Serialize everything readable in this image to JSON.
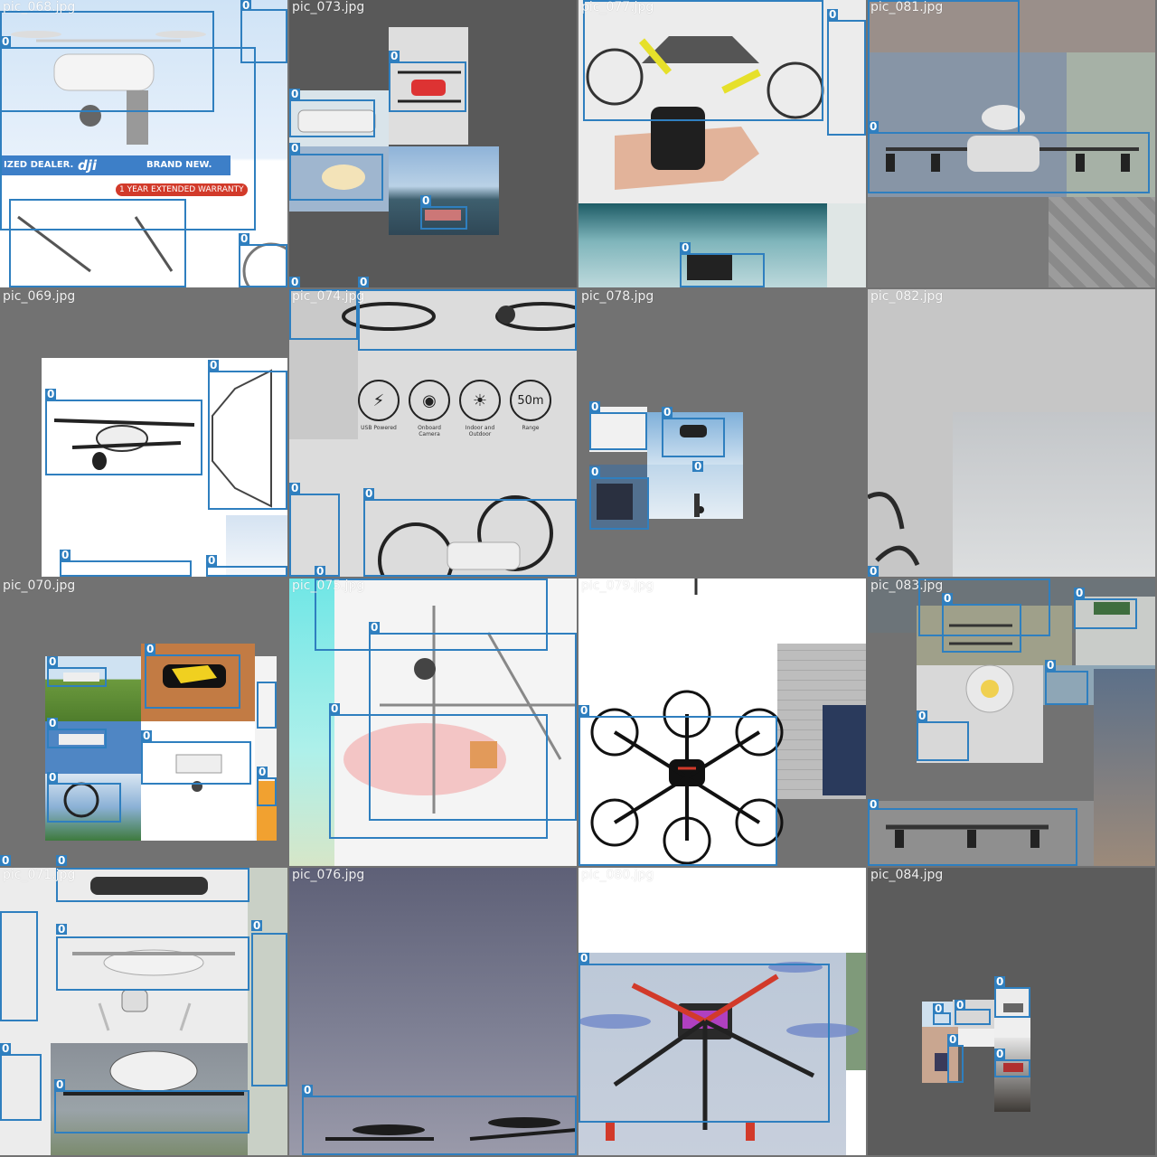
{
  "mosaic": {
    "class_label": "0",
    "box_color": "#2f7fbf",
    "tiles": [
      {
        "name": "pic_068.jpg",
        "label": "pic_068.jpg"
      },
      {
        "name": "pic_073.jpg",
        "label": "pic_073.jpg"
      },
      {
        "name": "pic_077.jpg",
        "label": "pic_077.jpg"
      },
      {
        "name": "pic_081.jpg",
        "label": "pic_081.jpg"
      },
      {
        "name": "pic_069.jpg",
        "label": "pic_069.jpg"
      },
      {
        "name": "pic_074.jpg",
        "label": "pic_074.jpg"
      },
      {
        "name": "pic_078.jpg",
        "label": "pic_078.jpg"
      },
      {
        "name": "pic_082.jpg",
        "label": "pic_082.jpg"
      },
      {
        "name": "pic_070.jpg",
        "label": "pic_070.jpg"
      },
      {
        "name": "pic_075.jpg",
        "label": "pic_075.jpg"
      },
      {
        "name": "pic_079.jpg",
        "label": "pic_079.jpg"
      },
      {
        "name": "pic_083.jpg",
        "label": "pic_083.jpg"
      },
      {
        "name": "pic_071.jpg",
        "label": "pic_071.jpg"
      },
      {
        "name": "pic_076.jpg",
        "label": "pic_076.jpg"
      },
      {
        "name": "pic_080.jpg",
        "label": "pic_080.jpg"
      },
      {
        "name": "pic_084.jpg",
        "label": "pic_084.jpg"
      }
    ]
  },
  "dealer_banner": {
    "authorized": "IZED DEALER.",
    "brand": "dji",
    "brand_new": "BRAND NEW.",
    "warranty": "1 YEAR EXTENDED WARRANTY"
  },
  "feature_icons": [
    {
      "symbol": "⚡",
      "label": "USB Powered",
      "icon": "usb-icon"
    },
    {
      "symbol": "◉",
      "label": "Onboard Camera",
      "icon": "camera-icon"
    },
    {
      "symbol": "☀",
      "label": "Indoor and Outdoor",
      "icon": "sun-icon"
    },
    {
      "symbol": "50m",
      "label": "Range",
      "icon": "range-icon"
    }
  ],
  "colors": {
    "gray_tile": "#727272",
    "light_tile": "#dcdcdc",
    "sky": "#cfdfee",
    "accent_red": "#d23a2a"
  }
}
